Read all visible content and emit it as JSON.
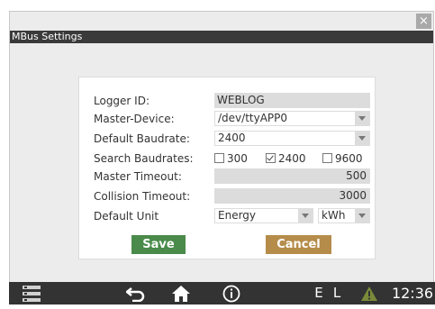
{
  "window": {
    "title": "MBus Settings",
    "close_glyph": "×"
  },
  "form": {
    "logger_id": {
      "label": "Logger ID:",
      "value": "WEBLOG"
    },
    "master_device": {
      "label": "Master-Device:",
      "value": "/dev/ttyAPP0"
    },
    "default_baudrate": {
      "label": "Default Baudrate:",
      "value": "2400"
    },
    "search_baudrates": {
      "label": "Search Baudrates:",
      "options": [
        {
          "label": "300",
          "checked": false
        },
        {
          "label": "2400",
          "checked": true
        },
        {
          "label": "9600",
          "checked": false
        }
      ]
    },
    "master_timeout": {
      "label": "Master Timeout:",
      "value": "500"
    },
    "collision_timeout": {
      "label": "Collision Timeout:",
      "value": "3000"
    },
    "default_unit": {
      "label": "Default Unit",
      "value": "Energy",
      "unit": "kWh"
    }
  },
  "buttons": {
    "save": "Save",
    "cancel": "Cancel"
  },
  "taskbar": {
    "status_e": "E",
    "status_l": "L",
    "clock": "12:36",
    "icons": [
      "menu-icon",
      "back-icon",
      "home-icon",
      "info-icon",
      "warning-icon"
    ]
  },
  "colors": {
    "save_button": "#4a8a4a",
    "cancel_button": "#b58c4a",
    "titlebar": "#3a3a3a",
    "taskbar": "#333333",
    "warning_icon": "#7a8a3a"
  }
}
